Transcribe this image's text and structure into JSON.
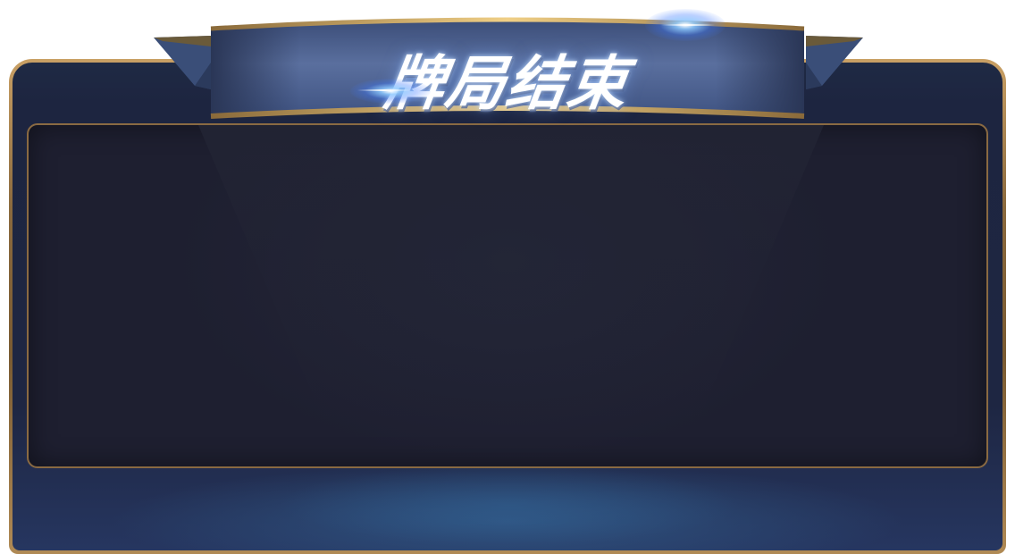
{
  "dialog": {
    "title": "牌局结束"
  },
  "colors": {
    "frame_gold": "#c9a065",
    "panel_bg": "#1e1f30",
    "banner_blue": "#4b5f8c",
    "sparkle_blue": "#5a8cff"
  },
  "icons": {
    "sparkle": "sparkle-icon"
  }
}
